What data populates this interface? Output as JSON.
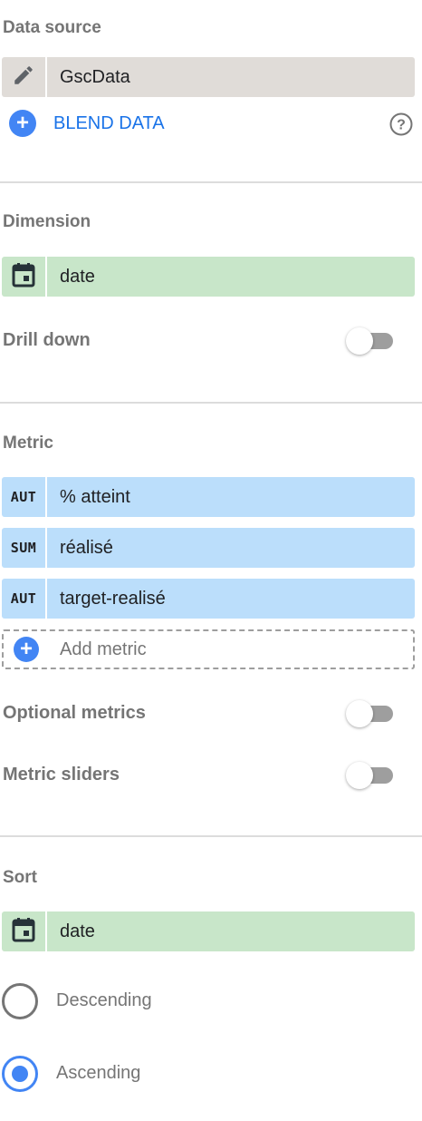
{
  "data_source": {
    "title": "Data source",
    "name": "GscData",
    "edit_icon": "pencil-icon",
    "blend_label": "BLEND DATA",
    "help_icon": "help-circle-icon"
  },
  "dimension": {
    "title": "Dimension",
    "field": "date",
    "field_icon": "calendar-icon",
    "drill_down_label": "Drill down",
    "drill_down_enabled": false
  },
  "metric": {
    "title": "Metric",
    "items": [
      {
        "aggregation": "AUT",
        "label": "% atteint"
      },
      {
        "aggregation": "SUM",
        "label": "réalisé"
      },
      {
        "aggregation": "AUT",
        "label": "target-realisé"
      }
    ],
    "add_label": "Add metric",
    "optional_metrics_label": "Optional metrics",
    "optional_metrics_enabled": false,
    "metric_sliders_label": "Metric sliders",
    "metric_sliders_enabled": false
  },
  "sort": {
    "title": "Sort",
    "field": "date",
    "field_icon": "calendar-icon",
    "options": [
      {
        "label": "Descending",
        "selected": false
      },
      {
        "label": "Ascending",
        "selected": true
      }
    ]
  },
  "colors": {
    "accent": "#4285f4",
    "blend_link": "#1a73e8",
    "dimension_chip": "#c8e6c9",
    "metric_chip": "#bbdefb",
    "datasource_chip": "#e0dcd8",
    "section_title": "#757575"
  }
}
